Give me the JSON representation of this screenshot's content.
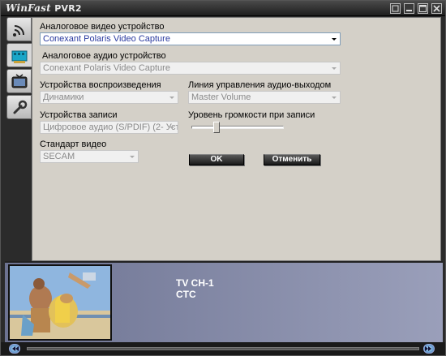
{
  "window": {
    "app_name": "WinFast",
    "app_version": "PVR2"
  },
  "tabs": [
    {
      "icon": "signal-icon"
    },
    {
      "icon": "capture-card-icon"
    },
    {
      "icon": "tv-icon"
    },
    {
      "icon": "wrench-icon"
    }
  ],
  "form": {
    "video_device_label": "Аналоговое видео устройство",
    "video_device_value": "Conexant Polaris Video Capture",
    "audio_device_label": "Аналоговое аудио устройство",
    "audio_device_value": "Conexant Polaris Video Capture",
    "playback_label": "Устройства воспроизведения",
    "playback_value": "Динамики",
    "output_line_label": "Линия управления аудио-выходом",
    "output_line_value": "Master Volume",
    "record_device_label": "Устройства записи",
    "record_device_value": "Цифровое аудио (S/PDIF) (2- Уст",
    "record_volume_label": "Уровень громкости при записи",
    "record_volume_level": 0.25,
    "video_standard_label": "Стандарт видео",
    "video_standard_value": "SECAM",
    "ok_label": "OK",
    "cancel_label": "Отменить"
  },
  "preview": {
    "channel": "TV CH-1",
    "station": "CTC"
  },
  "colors": {
    "panel_bg": "#d4d0c8",
    "frame": "#2b2b2b",
    "preview_bg": "#7b81a0"
  }
}
